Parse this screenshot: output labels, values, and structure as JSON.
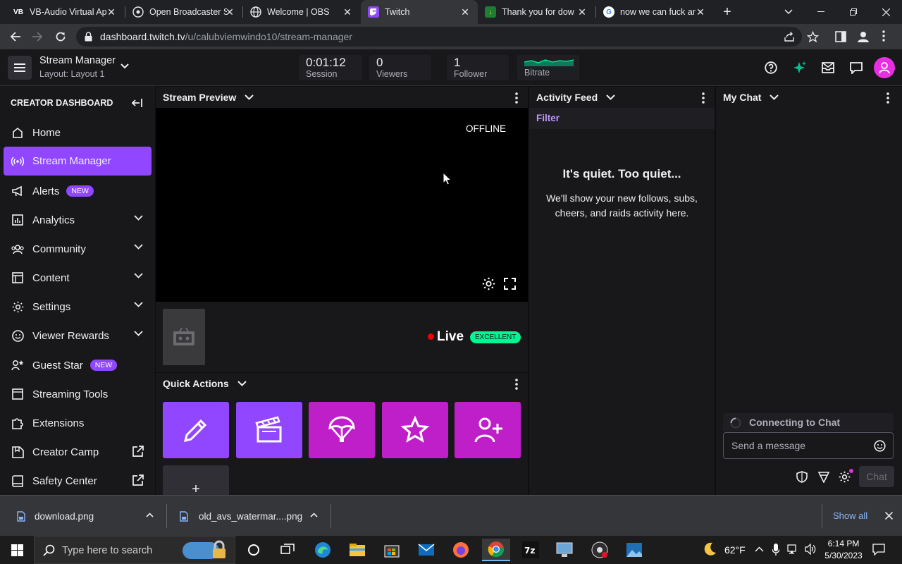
{
  "browser": {
    "tabs": [
      {
        "title": "VB-Audio Virtual Ap",
        "favicon": "VB"
      },
      {
        "title": "Open Broadcaster S",
        "favicon": "obs-icon"
      },
      {
        "title": "Welcome | OBS",
        "favicon": "globe-icon"
      },
      {
        "title": "Twitch",
        "favicon": "twitch-icon"
      },
      {
        "title": "Thank you for dow",
        "favicon": "download-icon"
      },
      {
        "title": "now we can fuck ar",
        "favicon": "google-icon"
      }
    ],
    "url_host": "dashboard.twitch.tv",
    "url_path": "/u/calubviemwindo10/stream-manager"
  },
  "topbar": {
    "title": "Stream Manager",
    "layout": "Layout: Layout 1",
    "stats": [
      {
        "value": "0:01:12",
        "label": "Session"
      },
      {
        "value": "0",
        "label": "Viewers"
      },
      {
        "value": "1",
        "label": "Follower"
      },
      {
        "value": "",
        "label": "Bitrate"
      }
    ]
  },
  "sidebar": {
    "header": "CREATOR DASHBOARD",
    "items": [
      {
        "label": "Home"
      },
      {
        "label": "Stream Manager"
      },
      {
        "label": "Alerts",
        "badge": "NEW"
      },
      {
        "label": "Analytics"
      },
      {
        "label": "Community"
      },
      {
        "label": "Content"
      },
      {
        "label": "Settings"
      },
      {
        "label": "Viewer Rewards"
      },
      {
        "label": "Guest Star",
        "badge": "NEW"
      },
      {
        "label": "Streaming Tools"
      },
      {
        "label": "Extensions"
      },
      {
        "label": "Creator Camp"
      },
      {
        "label": "Safety Center"
      }
    ]
  },
  "preview": {
    "title": "Stream Preview",
    "offline": "OFFLINE",
    "live_label": "Live",
    "quality": "EXCELLENT"
  },
  "quick_actions": {
    "title": "Quick Actions",
    "add": "+"
  },
  "activity": {
    "title": "Activity Feed",
    "filter": "Filter",
    "empty_title": "It's quiet. Too quiet...",
    "empty_body": "We'll show your new follows, subs, cheers, and raids activity here."
  },
  "chat": {
    "title": "My Chat",
    "connecting": "Connecting to Chat",
    "placeholder": "Send a message",
    "send": "Chat"
  },
  "downloads": {
    "items": [
      {
        "name": "download.png"
      },
      {
        "name": "old_avs_watermar....png"
      }
    ],
    "show_all": "Show all"
  },
  "taskbar": {
    "search_placeholder": "Type here to search",
    "weather": "62°F",
    "time": "6:14 PM",
    "date": "5/30/2023"
  },
  "colors": {
    "twitch_purple": "#9147ff",
    "quick_magenta": "#bf1fc9",
    "live_red": "#eb0400",
    "excellent_green": "#00f593"
  }
}
